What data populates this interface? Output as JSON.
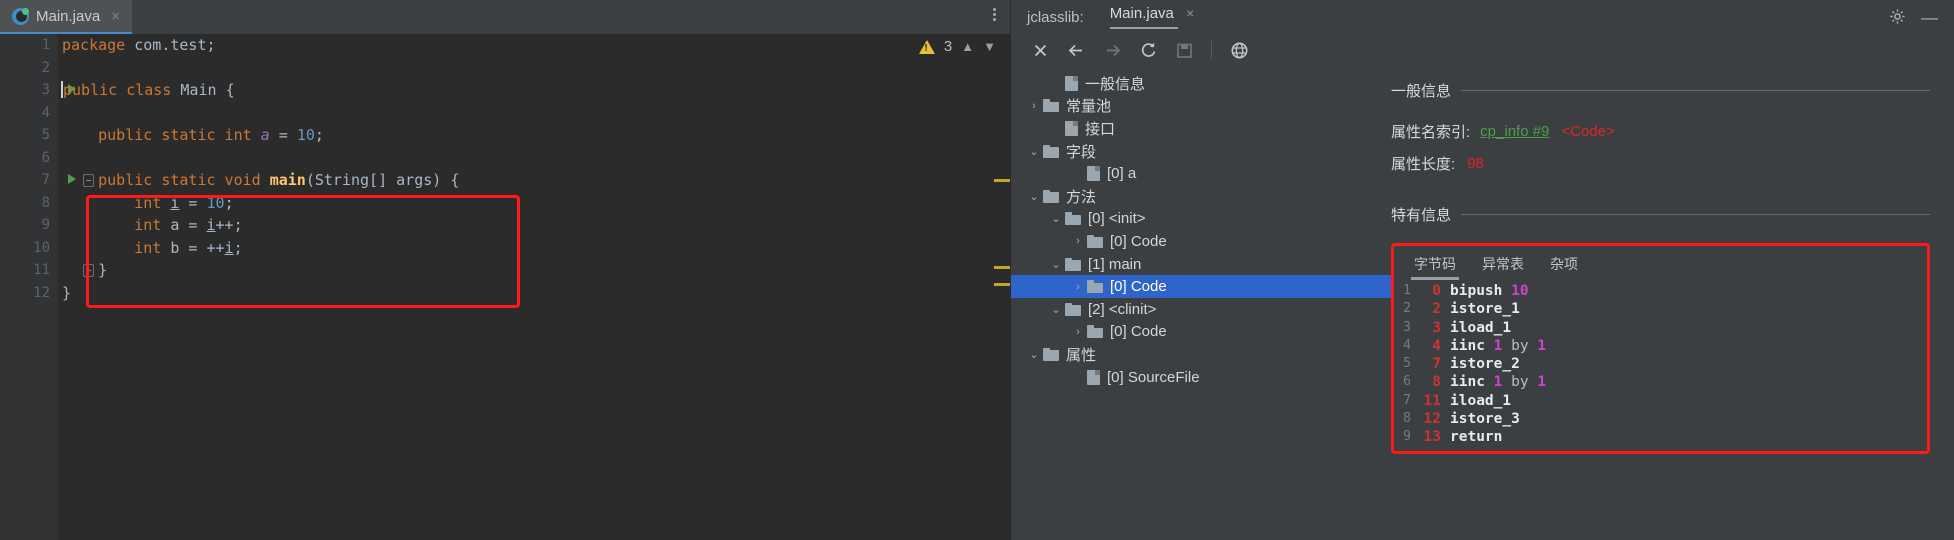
{
  "editor": {
    "tab": {
      "label": "Main.java",
      "close": "×",
      "icon": "intellij-class-icon"
    },
    "kebab_icon": "more-options-icon",
    "inspection": {
      "warning_icon": "warning-triangle-icon",
      "count": "3",
      "prev_icon": "chevron-up-icon",
      "next_icon": "chevron-down-icon"
    },
    "lines": [
      {
        "n": "1",
        "tokens": [
          {
            "t": "package ",
            "c": "kw"
          },
          {
            "t": "com.test;",
            "c": "ident"
          }
        ]
      },
      {
        "n": "2",
        "tokens": []
      },
      {
        "n": "3",
        "run": true,
        "caret": true,
        "tokens": [
          {
            "t": "public class ",
            "c": "kw"
          },
          {
            "t": "Main ",
            "c": "ident"
          },
          {
            "t": "{",
            "c": "ident"
          }
        ]
      },
      {
        "n": "4",
        "tokens": []
      },
      {
        "n": "5",
        "tokens": [
          {
            "t": "    ",
            "c": "ident"
          },
          {
            "t": "public static int ",
            "c": "kw"
          },
          {
            "t": "a",
            "c": "fld"
          },
          {
            "t": " = ",
            "c": "ident"
          },
          {
            "t": "10",
            "c": "num"
          },
          {
            "t": ";",
            "c": "ident"
          }
        ]
      },
      {
        "n": "6",
        "tokens": []
      },
      {
        "n": "7",
        "run": true,
        "fold": true,
        "tokens": [
          {
            "t": "    ",
            "c": "ident"
          },
          {
            "t": "public static void ",
            "c": "kw"
          },
          {
            "t": "main",
            "c": "mth"
          },
          {
            "t": "(String[] args) {",
            "c": "ident"
          }
        ]
      },
      {
        "n": "8",
        "tokens": [
          {
            "t": "        ",
            "c": "ident"
          },
          {
            "t": "int ",
            "c": "kw"
          },
          {
            "t": "i",
            "c": "ul"
          },
          {
            "t": " = ",
            "c": "ident"
          },
          {
            "t": "10",
            "c": "num"
          },
          {
            "t": ";",
            "c": "ident"
          }
        ]
      },
      {
        "n": "9",
        "tokens": [
          {
            "t": "        ",
            "c": "ident"
          },
          {
            "t": "int ",
            "c": "kw"
          },
          {
            "t": "a",
            "c": "ident"
          },
          {
            "t": " = ",
            "c": "ident"
          },
          {
            "t": "i",
            "c": "ul"
          },
          {
            "t": "++;",
            "c": "ident"
          }
        ]
      },
      {
        "n": "10",
        "tokens": [
          {
            "t": "        ",
            "c": "ident"
          },
          {
            "t": "int ",
            "c": "kw"
          },
          {
            "t": "b",
            "c": "ident"
          },
          {
            "t": " = ++",
            "c": "ident"
          },
          {
            "t": "i",
            "c": "ul"
          },
          {
            "t": ";",
            "c": "ident"
          }
        ]
      },
      {
        "n": "11",
        "fold2": true,
        "tokens": [
          {
            "t": "    }",
            "c": "ident"
          }
        ]
      },
      {
        "n": "12",
        "tokens": [
          {
            "t": "}",
            "c": "ident"
          }
        ]
      }
    ]
  },
  "tool": {
    "title": "jclasslib:",
    "tab_label": "Main.java",
    "tab_close": "×",
    "gear_icon": "settings-gear-icon",
    "minimize_icon": "minimize-icon",
    "toolbar": [
      {
        "name": "close-icon",
        "glyph": "✕",
        "dim": false
      },
      {
        "name": "back-arrow-icon",
        "glyph": "←",
        "dim": false
      },
      {
        "name": "forward-arrow-icon",
        "glyph": "→",
        "dim": true
      },
      {
        "name": "reload-icon",
        "glyph": "↻",
        "dim": false
      },
      {
        "name": "save-icon",
        "glyph": "὚b",
        "dim": true
      },
      {
        "name": "separator",
        "glyph": "",
        "dim": true
      },
      {
        "name": "browse-web-icon",
        "glyph": "ἱ0",
        "dim": false
      }
    ],
    "tree": [
      {
        "label": "一般信息",
        "indent": 1,
        "twisty": "",
        "icon": "file",
        "selected": false
      },
      {
        "label": "常量池",
        "indent": 0,
        "twisty": "›",
        "icon": "folder",
        "selected": false
      },
      {
        "label": "接口",
        "indent": 1,
        "twisty": "",
        "icon": "file",
        "selected": false
      },
      {
        "label": "字段",
        "indent": 0,
        "twisty": "⌄",
        "icon": "folder",
        "selected": false
      },
      {
        "label": "[0] a",
        "indent": 2,
        "twisty": "",
        "icon": "file",
        "selected": false
      },
      {
        "label": "方法",
        "indent": 0,
        "twisty": "⌄",
        "icon": "folder",
        "selected": false
      },
      {
        "label": "[0] <init>",
        "indent": 1,
        "twisty": "⌄",
        "icon": "folder",
        "selected": false
      },
      {
        "label": "[0] Code",
        "indent": 2,
        "twisty": "›",
        "icon": "folder",
        "selected": false
      },
      {
        "label": "[1] main",
        "indent": 1,
        "twisty": "⌄",
        "icon": "folder",
        "selected": false
      },
      {
        "label": "[0] Code",
        "indent": 2,
        "twisty": "›",
        "icon": "folder",
        "selected": true
      },
      {
        "label": "[2] <clinit>",
        "indent": 1,
        "twisty": "⌄",
        "icon": "folder",
        "selected": false
      },
      {
        "label": "[0] Code",
        "indent": 2,
        "twisty": "›",
        "icon": "folder",
        "selected": false
      },
      {
        "label": "属性",
        "indent": 0,
        "twisty": "⌄",
        "icon": "folder",
        "selected": false
      },
      {
        "label": "[0] SourceFile",
        "indent": 2,
        "twisty": "",
        "icon": "file",
        "selected": false
      }
    ],
    "detail": {
      "general_heading": "一般信息",
      "rows": [
        {
          "key": "属性名索引:",
          "link": "cp_info #9",
          "red": "<Code>"
        },
        {
          "key": "属性长度:",
          "link": "",
          "red": "98"
        }
      ],
      "specific_heading": "特有信息"
    },
    "bytecode": {
      "tabs": [
        {
          "label": "字节码",
          "active": true
        },
        {
          "label": "异常表",
          "active": false
        },
        {
          "label": "杂项",
          "active": false
        }
      ],
      "instructions": [
        {
          "line": "1",
          "offset": "0",
          "op": "bipush",
          "arg": "10",
          "by": ""
        },
        {
          "line": "2",
          "offset": "2",
          "op": "istore_1",
          "arg": "",
          "by": ""
        },
        {
          "line": "3",
          "offset": "3",
          "op": "iload_1",
          "arg": "",
          "by": ""
        },
        {
          "line": "4",
          "offset": "4",
          "op": "iinc",
          "arg": "1",
          "by": "by",
          "arg2": "1"
        },
        {
          "line": "5",
          "offset": "7",
          "op": "istore_2",
          "arg": "",
          "by": ""
        },
        {
          "line": "6",
          "offset": "8",
          "op": "iinc",
          "arg": "1",
          "by": "by",
          "arg2": "1"
        },
        {
          "line": "7",
          "offset": "11",
          "op": "iload_1",
          "arg": "",
          "by": ""
        },
        {
          "line": "8",
          "offset": "12",
          "op": "istore_3",
          "arg": "",
          "by": ""
        },
        {
          "line": "9",
          "offset": "13",
          "op": "return",
          "arg": "",
          "by": ""
        }
      ]
    }
  },
  "colors": {
    "accent_blue": "#2f65ca",
    "highlight_red": "#ff1a1a",
    "keyword_orange": "#cc7832",
    "number_blue": "#6897bb",
    "method_yellow": "#ffc66d",
    "link_green": "#4a9e4a",
    "value_red": "#dc2626",
    "operand_magenta": "#cc44cc",
    "warning_yellow": "#e8bf36"
  }
}
